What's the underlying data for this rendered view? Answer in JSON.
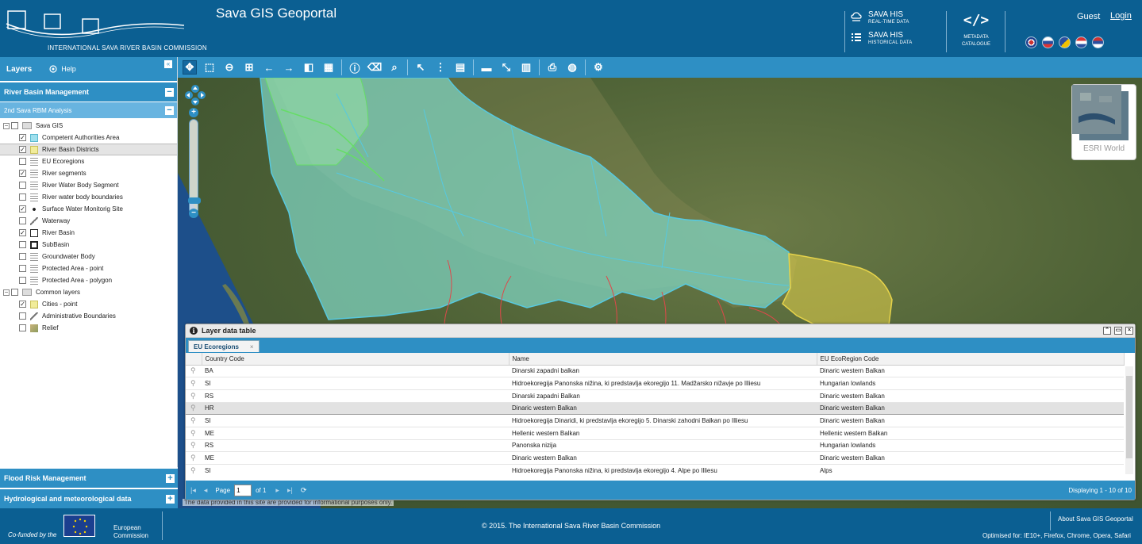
{
  "header": {
    "logo_text": "INTERNATIONAL SAVA RIVER BASIN COMMISSION",
    "app_title": "Sava GIS Geoportal",
    "his_realtime": {
      "title": "SAVA HIS",
      "subtitle": "REAL-TIME DATA"
    },
    "his_historical": {
      "title": "SAVA HIS",
      "subtitle": "HISTORICAL DATA"
    },
    "metadata": {
      "line1": "METADATA",
      "line2": "CATALOGUE"
    },
    "guest_label": "Guest",
    "login_label": "Login",
    "language_flags": [
      "gb-flag",
      "si-flag",
      "ba-flag",
      "hr-flag",
      "rs-flag"
    ]
  },
  "left_panel": {
    "layers_label": "Layers",
    "help_label": "Help",
    "sections": {
      "river_basin": "River Basin Management",
      "analysis": "2nd Sava RBM Analysis",
      "flood": "Flood Risk Management",
      "hydro": "Hydrological and meteorological data"
    },
    "tree": {
      "sava_gis": "Sava GIS",
      "common_layers": "Common layers",
      "layers": [
        {
          "label": "Competent Authorities Area",
          "checked": "✓"
        },
        {
          "label": "River Basin Districts",
          "checked": "✓"
        },
        {
          "label": "EU Ecoregions",
          "checked": ""
        },
        {
          "label": "River segments",
          "checked": "✓"
        },
        {
          "label": "River Water Body Segment",
          "checked": ""
        },
        {
          "label": "River water body boundaries",
          "checked": ""
        },
        {
          "label": "Surface Water Monitorig Site",
          "checked": "✓"
        },
        {
          "label": "Waterway",
          "checked": ""
        },
        {
          "label": "River Basin",
          "checked": "✓"
        },
        {
          "label": "SubBasin",
          "checked": ""
        },
        {
          "label": "Groundwater Body",
          "checked": ""
        },
        {
          "label": "Protected Area - point",
          "checked": ""
        },
        {
          "label": "Protected Area - polygon",
          "checked": ""
        }
      ],
      "common": [
        {
          "label": "Cities - point",
          "checked": "✓"
        },
        {
          "label": "Administrative Boundaries",
          "checked": ""
        },
        {
          "label": "Relief",
          "checked": ""
        }
      ]
    }
  },
  "toolbar": {
    "icons": [
      "pan-icon",
      "zoom-box-icon",
      "zoom-out-icon",
      "full-extent-icon",
      "back-icon",
      "forward-icon",
      "layers-icon",
      "grid-icon",
      "info-icon",
      "delete-icon",
      "search-icon",
      "select-icon",
      "table-select-icon",
      "clear-select-icon",
      "measure-icon",
      "measure-off-icon",
      "delete-measure-icon",
      "print-icon",
      "globe-icon",
      "settings-icon"
    ]
  },
  "map": {
    "basemap_label": "ESRI World",
    "disclaimer": "The data provided in this site are provided for informational purposes only."
  },
  "data_table": {
    "title": "Layer data table",
    "tab_label": "EU Ecoregions",
    "tab_close": "×",
    "columns": [
      "Country Code",
      "Name",
      "EU EcoRegion Code"
    ],
    "rows": [
      [
        "BA",
        "Dinarski zapadni balkan",
        "Dinaric western Balkan"
      ],
      [
        "SI",
        "Hidroekoregija Panonska nižina, ki predstavlja ekoregijo 11. Madžarsko nižavje po Illiesu",
        "Hungarian lowlands"
      ],
      [
        "RS",
        "Dinarski zapadni Balkan",
        "Dinaric western Balkan"
      ],
      [
        "HR",
        "Dinaric western Balkan",
        "Dinaric western Balkan"
      ],
      [
        "SI",
        "Hidroekoregija Dinaridi, ki predstavlja ekoregijo 5. Dinarski zahodni Balkan po Illiesu",
        "Dinaric western Balkan"
      ],
      [
        "ME",
        "Hellenic western Balkan",
        "Hellenic western Balkan"
      ],
      [
        "RS",
        "Panonska nizija",
        "Hungarian lowlands"
      ],
      [
        "ME",
        "Dinaric western Balkan",
        "Dinaric western Balkan"
      ],
      [
        "SI",
        "Hidroekoregija Panonska nižina, ki predstavlja ekoregijo 4. Alpe po Illiesu",
        "Alps"
      ]
    ],
    "selected_row": 3,
    "pager": {
      "page_label": "Page",
      "page_value": "1",
      "of_label": "of 1",
      "display_text": "Displaying 1 - 10 of 10"
    }
  },
  "footer": {
    "cofunded": "Co-funded by the",
    "eu_line1": "European",
    "eu_line2": "Commission",
    "copyright": "© 2015. The International Sava River Basin Commission",
    "about": "About Sava GIS Geoportal",
    "optimised": "Optimised for: IE10+, Firefox, Chrome, Opera, Safari"
  },
  "colors": {
    "header_bg": "#0b5f92",
    "toolbar_bg": "#2e8fc4",
    "basin_fill": "#7fd6c4",
    "ecoregion_fill": "#e6d34a",
    "boundary_red": "#e0484a"
  }
}
